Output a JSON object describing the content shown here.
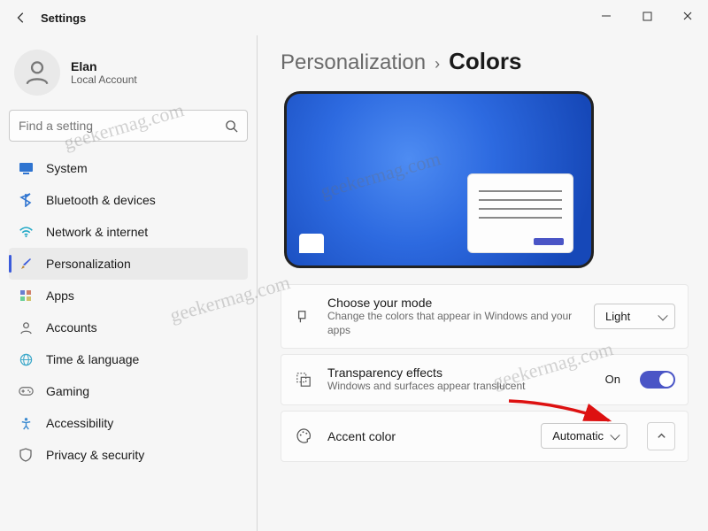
{
  "window": {
    "title": "Settings"
  },
  "user": {
    "name": "Elan",
    "sub": "Local Account"
  },
  "search": {
    "placeholder": "Find a setting"
  },
  "sidebar": {
    "items": [
      {
        "label": "System"
      },
      {
        "label": "Bluetooth & devices"
      },
      {
        "label": "Network & internet"
      },
      {
        "label": "Personalization"
      },
      {
        "label": "Apps"
      },
      {
        "label": "Accounts"
      },
      {
        "label": "Time & language"
      },
      {
        "label": "Gaming"
      },
      {
        "label": "Accessibility"
      },
      {
        "label": "Privacy & security"
      }
    ]
  },
  "breadcrumb": {
    "parent": "Personalization",
    "current": "Colors"
  },
  "settings": {
    "mode": {
      "title": "Choose your mode",
      "sub": "Change the colors that appear in Windows and your apps",
      "value": "Light"
    },
    "transparency": {
      "title": "Transparency effects",
      "sub": "Windows and surfaces appear translucent",
      "state": "On"
    },
    "accent": {
      "title": "Accent color",
      "value": "Automatic"
    }
  },
  "watermark": "geekermag.com"
}
